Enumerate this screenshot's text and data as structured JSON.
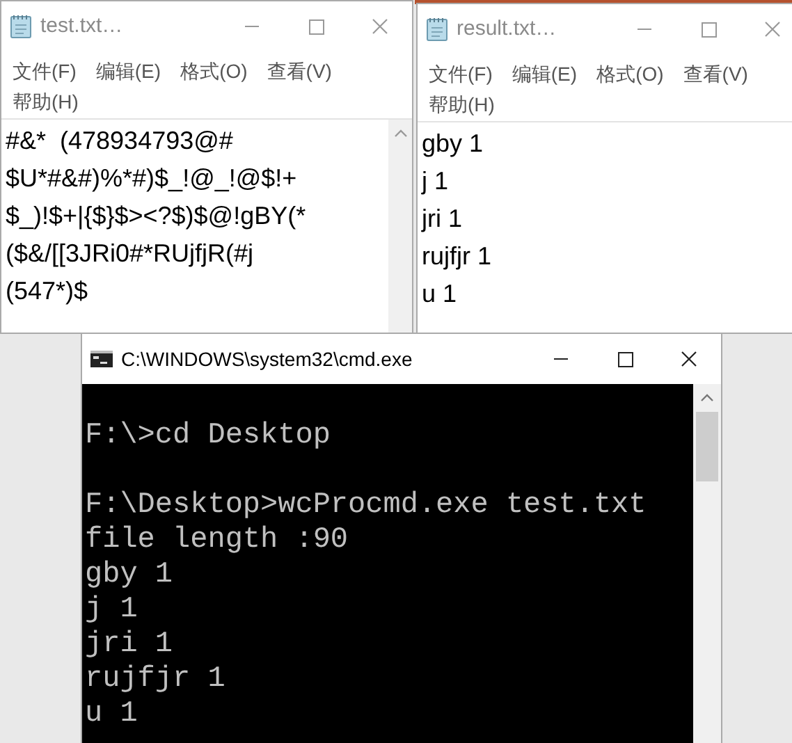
{
  "windows": [
    {
      "kind": "notepad",
      "title": "test.txt…",
      "menu": [
        "文件(F)",
        "编辑(E)",
        "格式(O)",
        "查看(V)",
        "帮助(H)"
      ],
      "scrollbar": true,
      "lines": [
        "#&*  (478934793@#",
        "$U*#&#)%*#)$_!@_!@$!+",
        "$_)!$+|{$}$><?$)$@!gBY(*",
        "($&/[[3JRi0#*RUjfjR(#j",
        "(547*)$"
      ]
    },
    {
      "kind": "notepad",
      "title": "result.txt…",
      "menu": [
        "文件(F)",
        "编辑(E)",
        "格式(O)",
        "查看(V)",
        "帮助(H)"
      ],
      "lines": [
        "gby 1",
        "j 1",
        "jri 1",
        "rujfjr 1",
        "u 1"
      ]
    },
    {
      "kind": "console",
      "title": "C:\\WINDOWS\\system32\\cmd.exe",
      "scrollbar": true,
      "lines": [
        {
          "text": "F:\\>cd Desktop",
          "gap_before": true
        },
        {
          "text": "F:\\Desktop>wcProcmd.exe test.txt",
          "gap_before": true
        },
        {
          "text": "file length :90",
          "gap_before": false
        },
        {
          "text": "gby 1",
          "gap_before": false
        },
        {
          "text": "j 1",
          "gap_before": false
        },
        {
          "text": "jri 1",
          "gap_before": false
        },
        {
          "text": "rujfjr 1",
          "gap_before": false
        },
        {
          "text": "u 1",
          "gap_before": false
        }
      ]
    }
  ]
}
